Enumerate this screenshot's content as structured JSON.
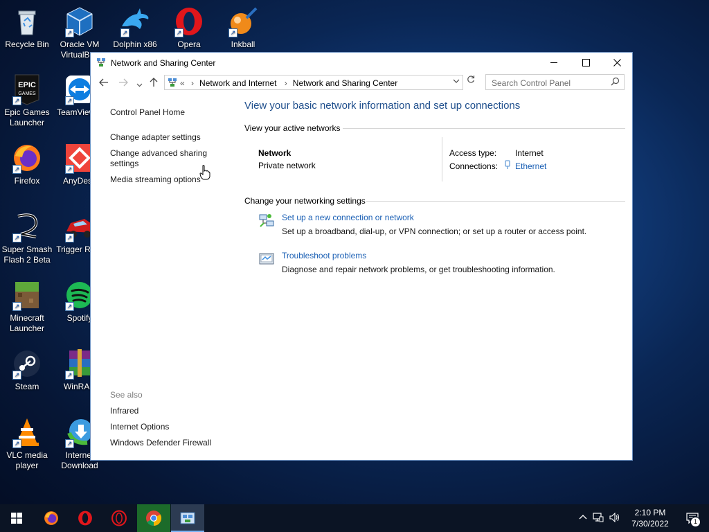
{
  "desktop": {
    "icons": [
      {
        "label": "Recycle Bin"
      },
      {
        "label": "Oracle VM VirtualBox"
      },
      {
        "label": "Dolphin x86"
      },
      {
        "label": "Opera"
      },
      {
        "label": "Inkball"
      },
      {
        "label": "Epic Games Launcher"
      },
      {
        "label": "TeamViewer"
      },
      {
        "label": "Firefox"
      },
      {
        "label": "AnyDesk"
      },
      {
        "label": "Super Smash Flash 2 Beta"
      },
      {
        "label": "Trigger Rally"
      },
      {
        "label": "Minecraft Launcher"
      },
      {
        "label": "Spotify"
      },
      {
        "label": "Steam"
      },
      {
        "label": "WinRAR"
      },
      {
        "label": "VLC media player"
      },
      {
        "label": "Internet Download Manager"
      }
    ]
  },
  "window": {
    "title": "Network and Sharing Center",
    "breadcrumb": {
      "overflow": "«",
      "items": [
        "Network and Internet",
        "Network and Sharing Center"
      ]
    },
    "search_placeholder": "Search Control Panel",
    "left_links": [
      "Control Panel Home",
      "Change adapter settings",
      "Change advanced sharing settings",
      "Media streaming options"
    ],
    "see_also": {
      "heading": "See also",
      "links": [
        "Infrared",
        "Internet Options",
        "Windows Defender Firewall"
      ]
    },
    "heading": "View your basic network information and set up connections",
    "active_networks": {
      "section_title": "View your active networks",
      "network_name": "Network",
      "network_category": "Private network",
      "access_type_label": "Access type:",
      "access_type_value": "Internet",
      "connections_label": "Connections:",
      "connections_value": "Ethernet"
    },
    "networking_settings": {
      "section_title": "Change your networking settings",
      "tasks": [
        {
          "title": "Set up a new connection or network",
          "description": "Set up a broadband, dial-up, or VPN connection; or set up a router or access point."
        },
        {
          "title": "Troubleshoot problems",
          "description": "Diagnose and repair network problems, or get troubleshooting information."
        }
      ]
    }
  },
  "taskbar": {
    "time": "2:10 PM",
    "date": "7/30/2022",
    "notification_count": "1"
  }
}
